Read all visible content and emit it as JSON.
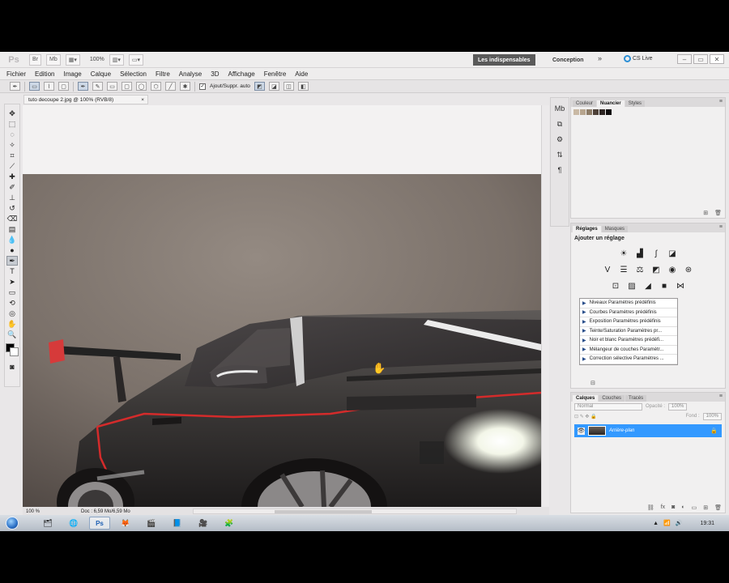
{
  "app": {
    "logo": "Ps",
    "zoom": "100%",
    "workspaces": {
      "active": "Les indispensables",
      "other": "Conception",
      "more": "»"
    },
    "cs_live": "CS Live",
    "window_controls": [
      "–",
      "▭",
      "✕"
    ]
  },
  "menu": [
    "Fichier",
    "Edition",
    "Image",
    "Calque",
    "Sélection",
    "Filtre",
    "Analyse",
    "3D",
    "Affichage",
    "Fenêtre",
    "Aide"
  ],
  "options": {
    "auto_add": "Ajout/Suppr. auto"
  },
  "document": {
    "tab_title": "tuto decoupe 2.jpg @ 100% (RVB/8)",
    "tab_close": "×",
    "status_zoom": "100 %",
    "status_doc": "Doc : 6,59 Mo/6,59 Mo"
  },
  "panels": {
    "color": {
      "tabs": [
        "Couleur",
        "Nuancier",
        "Styles"
      ],
      "active_tab": "Nuancier",
      "swatches": [
        "#c9b9a4",
        "#b7a58e",
        "#8c7b66",
        "#4d4037",
        "#2d2522",
        "#0f0c0c"
      ]
    },
    "adjust": {
      "tabs": [
        "Réglages",
        "Masques"
      ],
      "title": "Ajouter un réglage",
      "presets": [
        "Niveaux Paramètres prédéfinis",
        "Courbes Paramètres prédéfinis",
        "Exposition Paramètres prédéfinis",
        "Teinte/Saturation Paramètres pr...",
        "Noir et blanc Paramètres prédéfi...",
        "Mélangeur de couches Paramètr...",
        "Correction sélective Paramètres ..."
      ]
    },
    "layers": {
      "tabs": [
        "Calques",
        "Couches",
        "Tracés"
      ],
      "blend": "Normal",
      "opacity_label": "Opacité :",
      "opacity": "100%",
      "fill_label": "Fond :",
      "fill": "100%",
      "layer_name": "Arrière-plan"
    }
  },
  "taskbar": {
    "time": "19:31"
  }
}
